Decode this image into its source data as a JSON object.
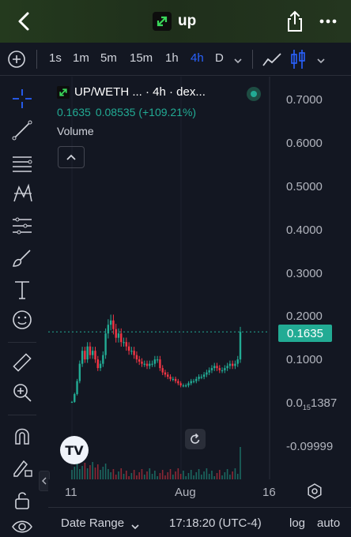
{
  "header": {
    "title": "up",
    "back_icon": "chevron-left-icon",
    "share_icon": "share-icon",
    "more_icon": "more-horizontal-icon"
  },
  "timeframes": {
    "items": [
      "1s",
      "1m",
      "5m",
      "15m",
      "1h",
      "4h",
      "D"
    ],
    "active": "4h"
  },
  "legend": {
    "symbol": "UP/WETH ... · 4h · dex...",
    "price": "0.1635",
    "change": "0.08535 (+109.21%)",
    "volume_label": "Volume",
    "status_color": "#22ab94"
  },
  "price_axis": {
    "labels": [
      "0.7000",
      "0.6000",
      "0.5000",
      "0.4000",
      "0.3000",
      "0.2000",
      "0.1000",
      "0.0",
      "15",
      "1387",
      "-0.09999"
    ],
    "current": "0.1635"
  },
  "time_axis": {
    "ticks": [
      "11",
      "Aug",
      "16"
    ]
  },
  "bottom_bar": {
    "date_range": "Date Range",
    "time": "17:18:20 (UTC-4)",
    "log": "log",
    "auto": "auto"
  },
  "colors": {
    "up": "#22ab94",
    "down": "#f23645",
    "accent": "#2962ff",
    "background": "#131722"
  },
  "chart_data": {
    "type": "candlestick",
    "interval": "4h",
    "y_unit": "UP/WETH",
    "ylim": [
      -0.1,
      0.75
    ],
    "current_price": 0.1635,
    "close_series": [
      0.002,
      0.02,
      0.05,
      0.09,
      0.12,
      0.1,
      0.13,
      0.11,
      0.12,
      0.1,
      0.08,
      0.09,
      0.11,
      0.16,
      0.18,
      0.19,
      0.17,
      0.15,
      0.16,
      0.14,
      0.14,
      0.13,
      0.12,
      0.12,
      0.11,
      0.1,
      0.095,
      0.09,
      0.09,
      0.085,
      0.09,
      0.09,
      0.1,
      0.1,
      0.08,
      0.07,
      0.065,
      0.06,
      0.055,
      0.055,
      0.05,
      0.045,
      0.04,
      0.04,
      0.04,
      0.045,
      0.05,
      0.05,
      0.055,
      0.06,
      0.06,
      0.065,
      0.07,
      0.075,
      0.08,
      0.085,
      0.08,
      0.075,
      0.075,
      0.08,
      0.085,
      0.09,
      0.085,
      0.09,
      0.1,
      0.1635
    ]
  }
}
